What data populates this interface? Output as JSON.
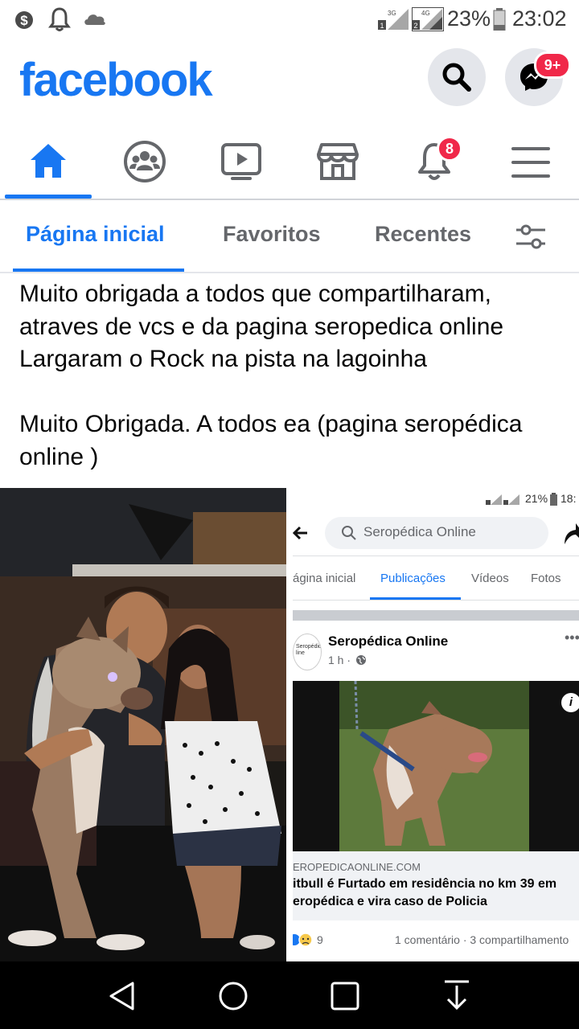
{
  "status_bar": {
    "battery": "23%",
    "time": "23:02",
    "net1": "3G",
    "net2": "4G",
    "icons": [
      "dollar-icon",
      "bell-outline-icon",
      "cloud-icon",
      "signal-icon",
      "battery-icon"
    ]
  },
  "header": {
    "logo": "facebook",
    "messenger_badge": "9+"
  },
  "nav": {
    "items": [
      "home-icon",
      "groups-icon",
      "watch-icon",
      "marketplace-icon",
      "notifications-icon",
      "menu-icon"
    ],
    "notifications_badge": "8"
  },
  "tabs": {
    "home": "Página inicial",
    "favorites": "Favoritos",
    "recent": "Recentes"
  },
  "post": {
    "lines": [
      "Muito obrigada a todos que compartilharam,",
      "atraves de vcs e da pagina seropedica online",
      "Largaram o Rock na pista na lagoinha",
      "Muito Obrigada. A todos ea (pagina seropédica",
      "online )"
    ]
  },
  "screenshot": {
    "battery": "21%",
    "time": "18:",
    "search": "Seropédica Online",
    "tabs": [
      "ágina inicial",
      "Publicações",
      "Vídeos",
      "Fotos"
    ],
    "page_name": "Seropédica Online",
    "avatar_text": "Seropédica\nline",
    "meta": "1 h ·",
    "link_domain": "EROPEDICAONLINE.COM",
    "link_title_1": "itbull é Furtado em residência no km 39 em",
    "link_title_2": "eropédica e vira caso de Policia",
    "reactions": "9",
    "stats": "1 comentário · 3 compartilhamento"
  },
  "colors": {
    "brand": "#1877f2",
    "badge": "#f02849",
    "inactive": "#65676b"
  }
}
